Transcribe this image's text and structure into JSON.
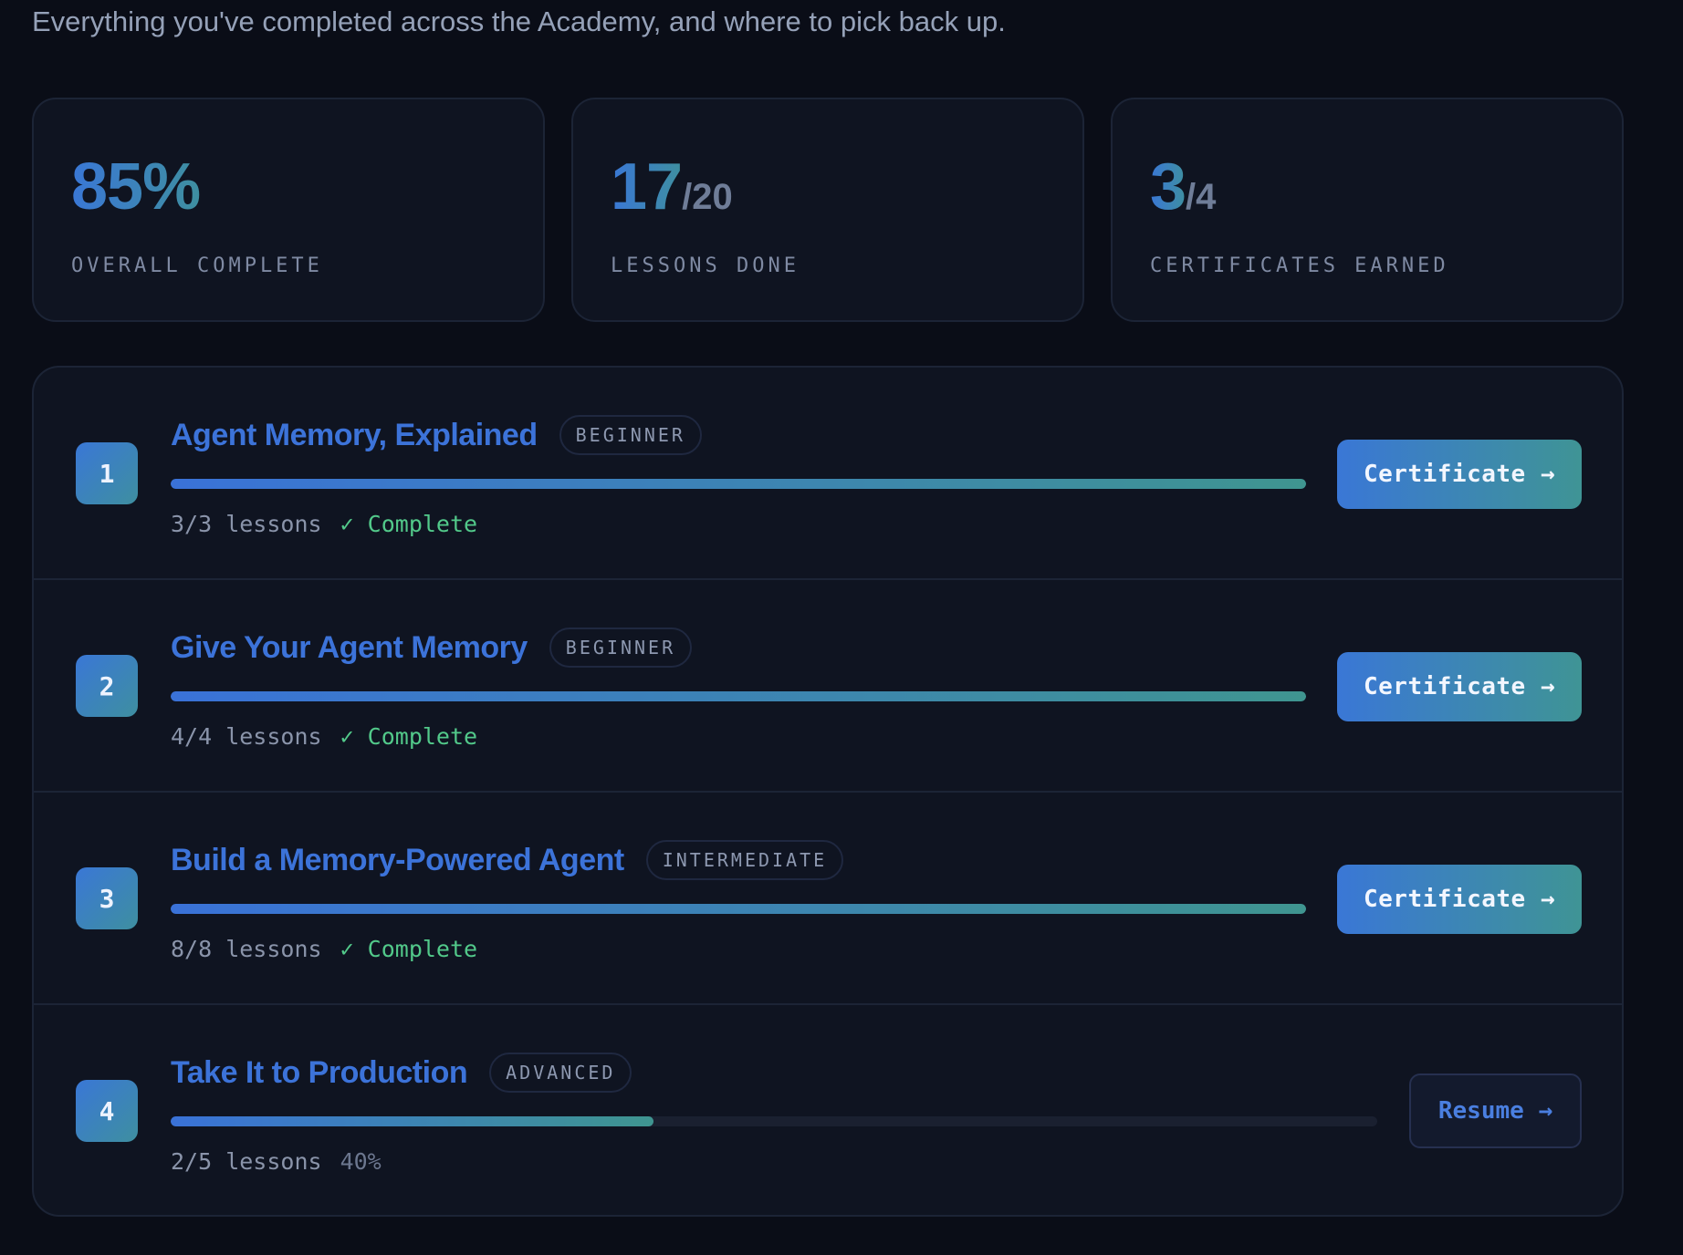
{
  "page": {
    "subtitle": "Everything you've completed across the Academy, and where to pick back up."
  },
  "stats": [
    {
      "value": "85%",
      "suffix": "",
      "label": "OVERALL COMPLETE"
    },
    {
      "value": "17",
      "suffix": "/20",
      "label": "LESSONS DONE"
    },
    {
      "value": "3",
      "suffix": "/4",
      "label": "CERTIFICATES EARNED"
    }
  ],
  "courses": [
    {
      "number": "1",
      "title": "Agent Memory, Explained",
      "level": "BEGINNER",
      "lessons": "3/3 lessons",
      "status": "✓ Complete",
      "progress": 1.0,
      "action": "Certificate →"
    },
    {
      "number": "2",
      "title": "Give Your Agent Memory",
      "level": "BEGINNER",
      "lessons": "4/4 lessons",
      "status": "✓ Complete",
      "progress": 1.0,
      "action": "Certificate →"
    },
    {
      "number": "3",
      "title": "Build a Memory-Powered Agent",
      "level": "INTERMEDIATE",
      "lessons": "8/8 lessons",
      "status": "✓ Complete",
      "progress": 1.0,
      "action": "Certificate →"
    },
    {
      "number": "4",
      "title": "Take It to Production",
      "level": "ADVANCED",
      "lessons": "2/5 lessons",
      "percent": "40%",
      "progress": 0.4,
      "action": "Resume →"
    }
  ],
  "colors": {
    "accent_start": "#3a77d6",
    "accent_end": "#3f9495",
    "complete": "#52c98a",
    "background": "#0a0d17"
  }
}
